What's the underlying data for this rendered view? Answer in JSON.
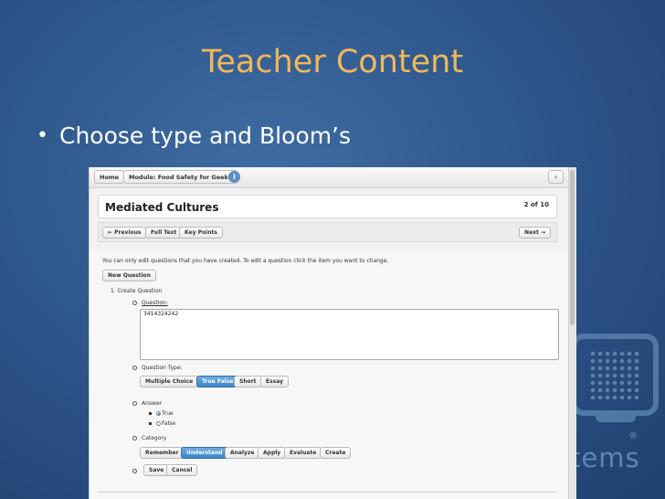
{
  "slide": {
    "title": "Teacher Content",
    "bullet": "Choose type and Bloom’s",
    "watermark_text": "tems",
    "watermark_reg": "®"
  },
  "app": {
    "breadcrumbs": [
      "Home",
      "Module: Food Safety for Geeks"
    ],
    "info_icon": "info-icon",
    "back_icon": "‹",
    "header_title": "Mediated Cultures",
    "page_indicator": "2 of 10",
    "nav": {
      "previous": "← Previous",
      "full_text": "Full Text",
      "key_points": "Key Points",
      "next": "Next →"
    },
    "info_text": "You can only edit questions that you have created. To edit a question click the item you want to change.",
    "new_question": "New Question",
    "step_label": "1.  Create Question",
    "question_label": "Question:",
    "question_value": "3414324242",
    "question_type_label": "Question Type:",
    "question_types": [
      "Multiple Choice",
      "True False",
      "Short",
      "Essay"
    ],
    "question_type_selected": "True False",
    "answer_label": "Answer",
    "answers": [
      {
        "label": "True",
        "checked": true
      },
      {
        "label": "False",
        "checked": false
      }
    ],
    "category_label": "Category",
    "categories": [
      "Remember",
      "Understand",
      "Analyze",
      "Apply",
      "Evaluate",
      "Create"
    ],
    "category_selected": "Understand",
    "save_label": "Save",
    "cancel_label": "Cancel"
  },
  "colors": {
    "title": "#f0b75a",
    "accent": "#3b84c9",
    "background": "#2c5387"
  }
}
